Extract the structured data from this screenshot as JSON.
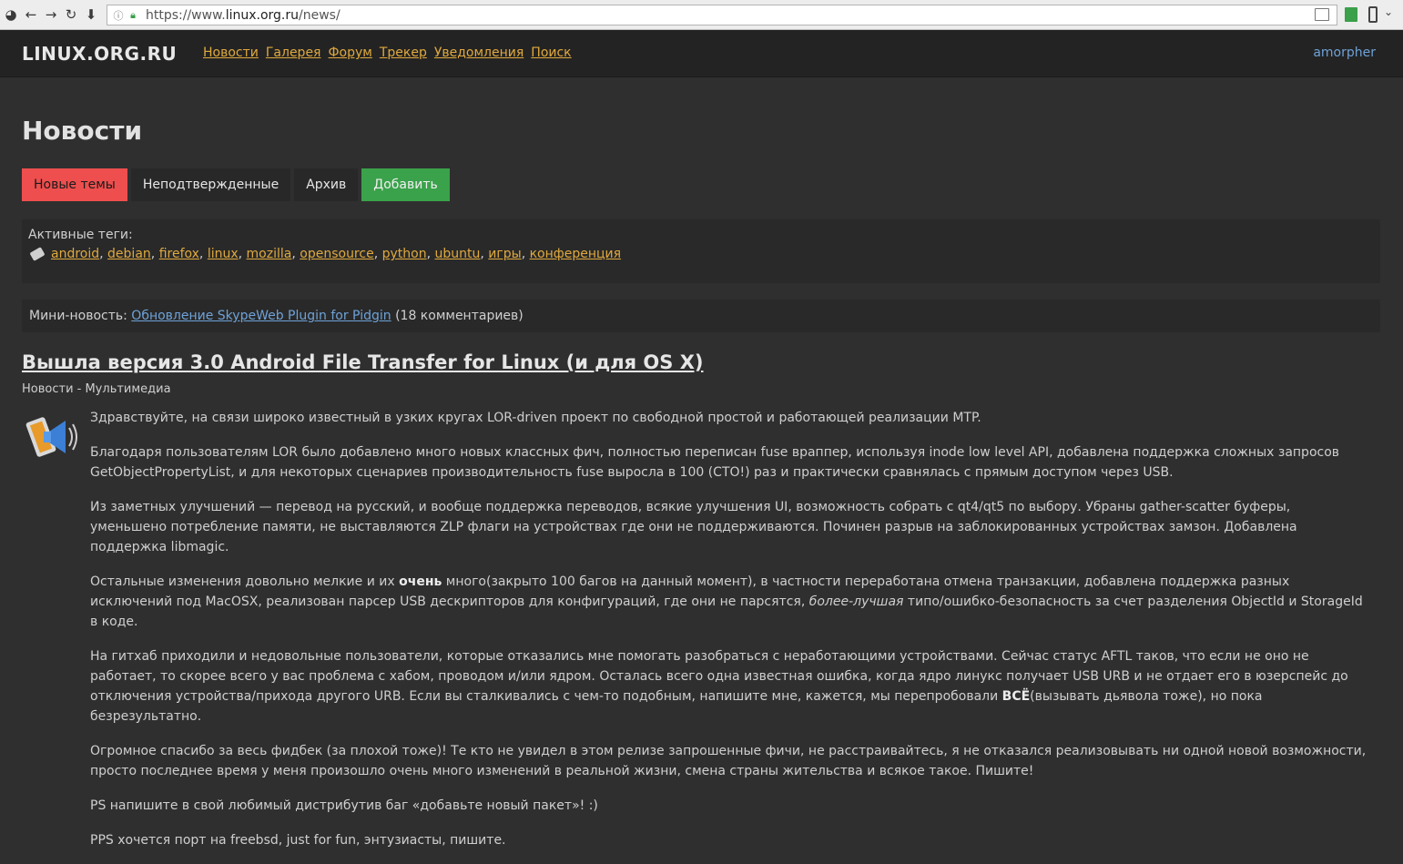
{
  "browser": {
    "url_scheme": "https://www.",
    "url_host": "linux.org.ru",
    "url_path": "/news/"
  },
  "header": {
    "logo": "LINUX.ORG.RU",
    "nav": [
      "Новости",
      "Галерея",
      "Форум",
      "Трекер",
      "Уведомления",
      "Поиск"
    ],
    "username": "amorpher"
  },
  "page": {
    "title": "Новости",
    "tabs": [
      "Новые темы",
      "Неподтвержденные",
      "Архив",
      "Добавить"
    ]
  },
  "tags": {
    "label": "Активные теги:",
    "items": [
      "android",
      "debian",
      "firefox",
      "linux",
      "mozilla",
      "opensource",
      "python",
      "ubuntu",
      "игры",
      "конференция"
    ]
  },
  "mini_news": {
    "label": "Мини-новость: ",
    "link": "Обновление SkypeWeb Plugin for Pidgin",
    "comments": " (18 комментариев)"
  },
  "article": {
    "title": "Вышла версия 3.0 Android File Transfer for Linux (и для OS X)",
    "meta": "Новости - Мультимедиа",
    "p1": "Здравствуйте, на связи широко известный в узких кругах LOR-driven проект по свободной простой и работающей реализации MTP.",
    "p2": "Благодаря пользователям LOR было добавлено много новых классных фич, полностью переписан fuse враппер, используя inode low level API, добавлена поддержка сложных запросов GetObjectPropertyList, и для некоторых сценариев производительность fuse выросла в 100 (СТО!) раз и практически сравнялась с прямым доступом через USB.",
    "p3": "Из заметных улучшений — перевод на русский, и вообще поддержка переводов, всякие улучшения UI, возможность собрать с qt4/qt5 по выбору. Убраны gather-scatter буферы, уменьшено потребление памяти, не выставляются ZLP флаги на устройствах где они не поддерживаются. Починен разрыв на заблокированных устройствах замзон. Добавлена поддержка libmagic.",
    "p4_a": "Остальные изменения довольно мелкие и их ",
    "p4_bold": "очень",
    "p4_b": " много(закрыто 100 багов на данный момент), в частности переработана отмена транзакции, добавлена поддержка разных исключений под MacOSX, реализован парсер USB дескрипторов для конфигураций, где они не парсятся, ",
    "p4_italic": "более-лучшая",
    "p4_c": " типо/ошибко-безопасность за счет разделения ObjectId и StorageId в коде.",
    "p5_a": "На гитхаб приходили и недовольные пользователи, которые отказались мне помогать разобраться с неработающими устройствами. Сейчас статус AFTL таков, что если не оно не работает, то скорее всего у вас проблема с хабом, проводом и/или ядром. Осталась всего одна известная ошибка, когда ядро линукс получает USB URB и не отдает его в юзерспейс до отключения устройства/прихода другого URB. Если вы сталкивались с чем-то подобным, напишите мне, кажется, мы перепробовали ",
    "p5_bold": "ВСЁ",
    "p5_b": "(вызывать дьявола тоже), но пока безрезультатно.",
    "p6": "Огромное спасибо за весь фидбек (за плохой тоже)! Те кто не увидел в этом релизе запрошенные фичи, не расстраивайтесь, я не отказался реализовывать ни одной новой возможности, просто последнее время у меня произошло очень много изменений в реальной жизни, смена страны жительства и всякое такое. Пишите!",
    "p7": "PS напишите в свой любимый дистрибутив баг «добавьте новый пакет»! :)",
    "p8": "PPS хочется порт на freebsd, just for fun, энтузиасты, пишите."
  },
  "colors": {
    "link_orange": "#e0a93e",
    "link_blue": "#6ea2d8",
    "tab_active": "#ee4e4e",
    "tab_add": "#3aa24a"
  }
}
